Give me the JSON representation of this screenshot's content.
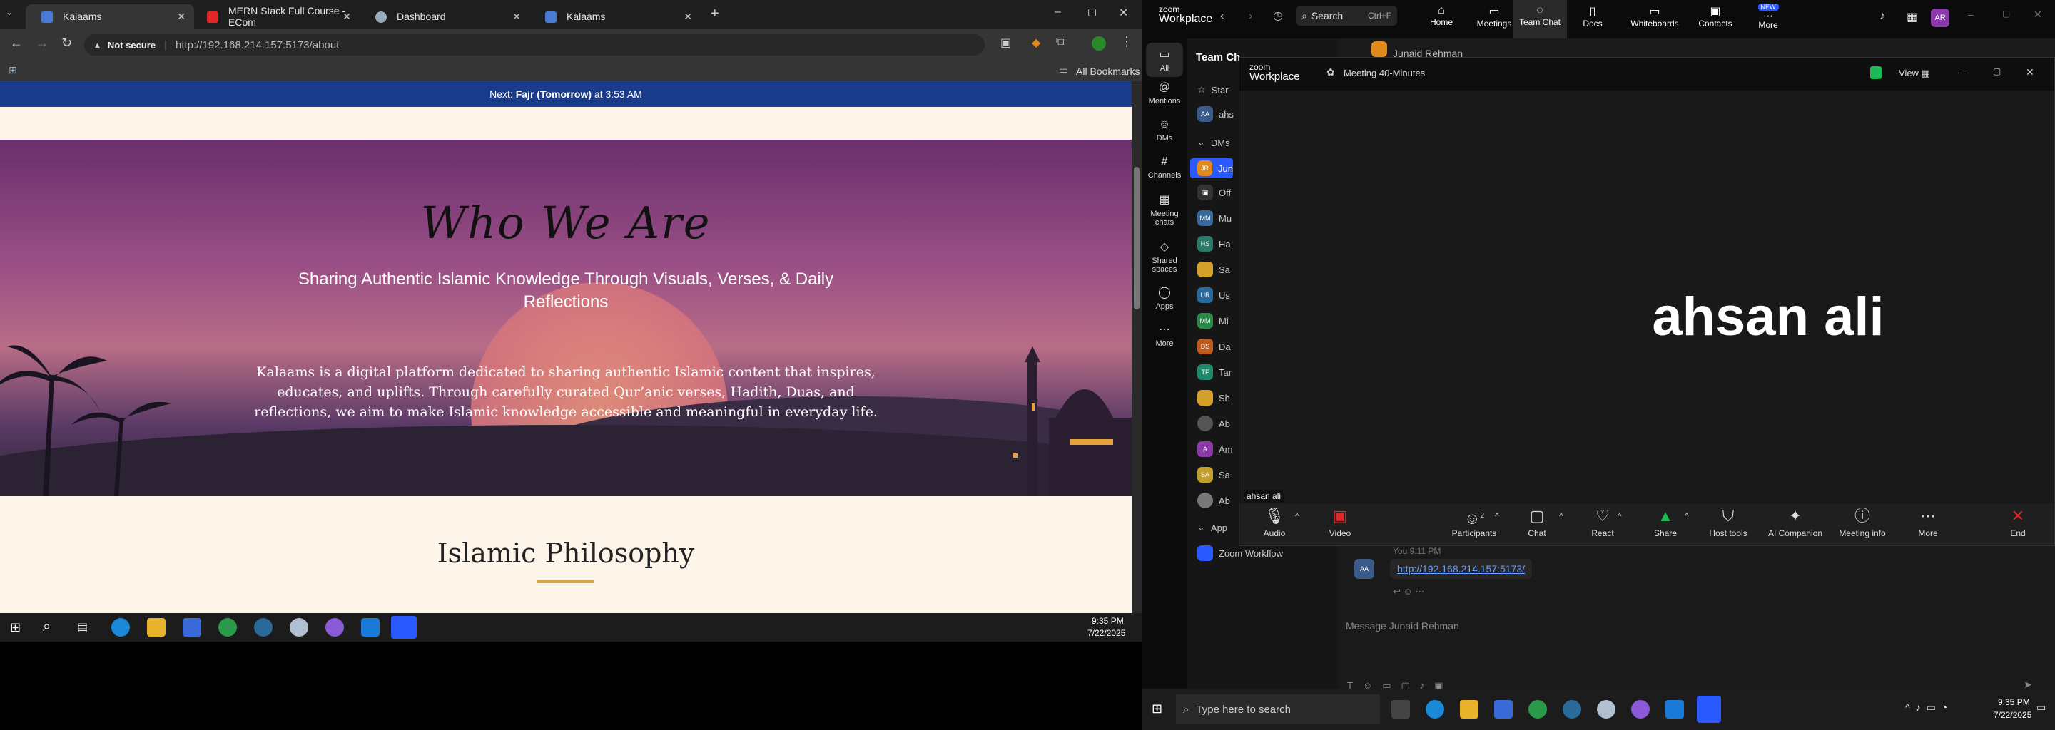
{
  "browser": {
    "tabs": [
      {
        "label": "Kalaams",
        "active": true
      },
      {
        "label": "MERN Stack Full Course - ECom",
        "active": false
      },
      {
        "label": "Dashboard",
        "active": false
      },
      {
        "label": "Kalaams",
        "active": false
      }
    ],
    "security": "Not secure",
    "url": "http://192.168.214.157:5173/about",
    "all_bookmarks": "All Bookmarks"
  },
  "site": {
    "prayer_prefix": "Next: ",
    "prayer_name": "Fajr (Tomorrow)",
    "prayer_suffix": " at 3:53 AM",
    "hero_title": "Who We Are",
    "hero_subtitle": "Sharing Authentic Islamic Knowledge Through Visuals, Verses, & Daily Reflections",
    "hero_body": "Kalaams is a digital platform dedicated to sharing authentic Islamic content that inspires, educates, and uplifts. Through carefully curated Qur’anic verses, Hadith, Duas, and reflections, we aim to make Islamic knowledge accessible and meaningful in everyday life.",
    "section_title": "Islamic Philosophy"
  },
  "taskbar_left": {
    "time": "9:35 PM",
    "date": "7/22/2025"
  },
  "zoom": {
    "brand_top": "zoom",
    "brand_bottom": "Workplace",
    "search": "Search",
    "search_shortcut": "Ctrl+F",
    "nav": [
      "Home",
      "Meetings",
      "Team Chat",
      "Docs",
      "Whiteboards",
      "Contacts",
      "More"
    ],
    "nav_badge": "NEW",
    "profile_initials": "AR",
    "rail": [
      "All",
      "Mentions",
      "DMs",
      "Channels",
      "Meeting chats",
      "Shared spaces",
      "Apps",
      "More"
    ],
    "list_title": "Team Ch",
    "contact_header": "Junaid Rehman",
    "list_items": [
      {
        "initials": "",
        "label": "Star",
        "color": ""
      },
      {
        "initials": "AA",
        "label": "ahs",
        "color": "#3a5a8a"
      },
      {
        "initials": "",
        "label": "DMs",
        "color": ""
      },
      {
        "initials": "JR",
        "label": "Jun",
        "color": "#e08a1e"
      },
      {
        "initials": "",
        "label": "Off",
        "color": "#444"
      },
      {
        "initials": "MM",
        "label": "Mu",
        "color": "#3a6a9a"
      },
      {
        "initials": "HS",
        "label": "Ha",
        "color": "#2a7a6a"
      },
      {
        "initials": "",
        "label": "Sa",
        "color": "#d4a02a"
      },
      {
        "initials": "UR",
        "label": "Us",
        "color": "#2a6a9a"
      },
      {
        "initials": "MM",
        "label": "Mi",
        "color": "#2a8a4a"
      },
      {
        "initials": "DS",
        "label": "Da",
        "color": "#c05a1a"
      },
      {
        "initials": "TF",
        "label": "Tar",
        "color": "#1a8a6a"
      },
      {
        "initials": "",
        "label": "Sh",
        "color": "#d4a02a"
      },
      {
        "initials": "",
        "label": "Ab",
        "color": "#555"
      },
      {
        "initials": "A",
        "label": "Am",
        "color": "#8a3aaa"
      },
      {
        "initials": "SA",
        "label": "Sa",
        "color": "#c0a02a"
      },
      {
        "initials": "",
        "label": "Ab",
        "color": "#777"
      },
      {
        "initials": "",
        "label": "App",
        "color": ""
      },
      {
        "initials": "",
        "label": "Zoom Workflow",
        "color": "#2a5aff"
      }
    ],
    "meeting": {
      "brand_top": "zoom",
      "brand_bottom": "Workplace",
      "title": "Meeting 40-Minutes",
      "view": "View",
      "participant_name": "ahsan ali",
      "name_tag": "ahsan ali",
      "controls": [
        {
          "label": "Audio",
          "icon": "microphone-icon"
        },
        {
          "label": "Video",
          "icon": "video-off-icon"
        },
        {
          "label": "Participants",
          "icon": "participants-icon",
          "count": "2"
        },
        {
          "label": "Chat",
          "icon": "chat-icon"
        },
        {
          "label": "React",
          "icon": "heart-icon"
        },
        {
          "label": "Share",
          "icon": "share-icon"
        },
        {
          "label": "Host tools",
          "icon": "shield-icon"
        },
        {
          "label": "AI Companion",
          "icon": "sparkle-icon"
        },
        {
          "label": "Meeting info",
          "icon": "info-icon"
        },
        {
          "label": "More",
          "icon": "more-icon"
        },
        {
          "label": "End",
          "icon": "end-icon"
        }
      ]
    },
    "chat": {
      "meta": "You 9:11 PM",
      "link": "http://192.168.214.157:5173/",
      "input_placeholder": "Message Junaid Rehman"
    }
  },
  "taskbar_right": {
    "search_placeholder": "Type here to search",
    "time": "9:35 PM",
    "date": "7/22/2025"
  },
  "colors": {
    "prayer_bar": "#1a3a8a",
    "accent_line": "#d9a441",
    "zoom_blue": "#2a5aff",
    "end_red": "#e02828",
    "share_green": "#1db954"
  }
}
